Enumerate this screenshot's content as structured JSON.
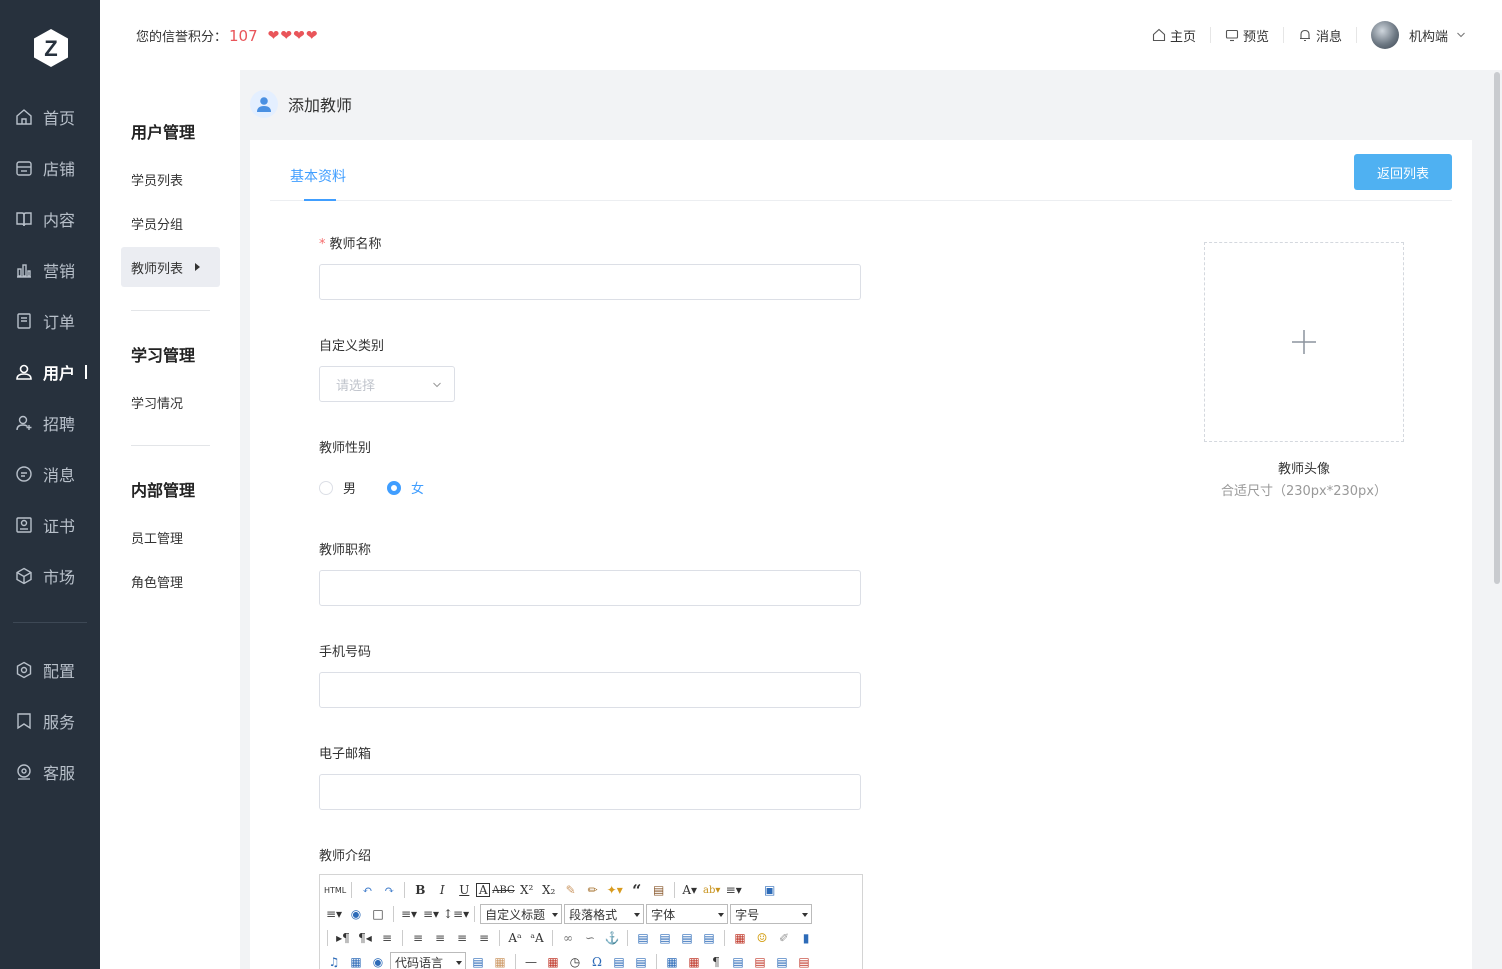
{
  "brand": {
    "logo_letter": "Z"
  },
  "leftnav": {
    "items": [
      {
        "label": "首页",
        "icon": "home-icon"
      },
      {
        "label": "店铺",
        "icon": "store-icon"
      },
      {
        "label": "内容",
        "icon": "book-icon"
      },
      {
        "label": "营销",
        "icon": "bar-chart-icon"
      },
      {
        "label": "订单",
        "icon": "order-icon"
      },
      {
        "label": "用户",
        "icon": "user-icon",
        "active": true
      },
      {
        "label": "招聘",
        "icon": "recruit-icon"
      },
      {
        "label": "消息",
        "icon": "message-icon"
      },
      {
        "label": "证书",
        "icon": "certificate-icon"
      },
      {
        "label": "市场",
        "icon": "market-icon"
      },
      {
        "label": "配置",
        "icon": "settings-icon"
      },
      {
        "label": "服务",
        "icon": "bookmark-icon"
      },
      {
        "label": "客服",
        "icon": "support-icon"
      }
    ]
  },
  "subnav": {
    "groups": [
      {
        "title": "用户管理",
        "items": [
          "学员列表",
          "学员分组",
          "教师列表"
        ]
      },
      {
        "title": "学习管理",
        "items": [
          "学习情况"
        ]
      },
      {
        "title": "内部管理",
        "items": [
          "员工管理",
          "角色管理"
        ]
      }
    ]
  },
  "topbar": {
    "credit_label": "您的信誉积分：",
    "credit_score": "107",
    "hearts": 4,
    "links": [
      {
        "label": "主页",
        "icon": "home-icon"
      },
      {
        "label": "预览",
        "icon": "monitor-icon"
      },
      {
        "label": "消息",
        "icon": "bell-icon"
      }
    ],
    "account_label": "机构端"
  },
  "page": {
    "title": "添加教师",
    "tab": "基本资料",
    "back_button": "返回列表"
  },
  "form": {
    "name_label": "教师名称",
    "required_mark": "*",
    "category_label": "自定义类别",
    "category_placeholder": "请选择",
    "gender_label": "教师性别",
    "gender_options": [
      "男",
      "女"
    ],
    "gender_selected": "女",
    "title_label": "教师职称",
    "phone_label": "手机号码",
    "email_label": "电子邮箱",
    "intro_label": "教师介绍"
  },
  "upload": {
    "label": "教师头像",
    "hint": "合适尺寸（230px*230px）"
  },
  "editor": {
    "html_label": "HTML",
    "selects": [
      "自定义标题",
      "段落格式",
      "字体",
      "字号",
      "代码语言"
    ]
  },
  "colors": {
    "nav_bg": "#27313d",
    "accent": "#409eff",
    "button": "#4fb1f2",
    "heart": "#e9555a"
  }
}
